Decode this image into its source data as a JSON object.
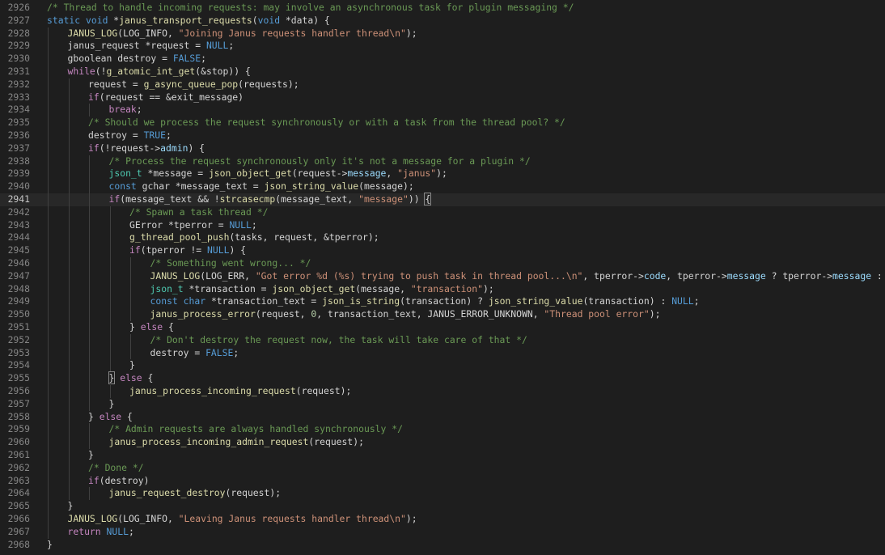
{
  "editor": {
    "active_line": 2941,
    "colors": {
      "background": "#1e1e1e",
      "line_number": "#858585",
      "active_line_number": "#c6c6c6",
      "keyword": "#569cd6",
      "control": "#c586c0",
      "function": "#dcdcaa",
      "type": "#4ec9b0",
      "variable": "#9cdcfe",
      "string": "#ce9178",
      "number": "#b5cea8",
      "comment": "#6a9955",
      "default": "#d4d4d4"
    },
    "lines": [
      {
        "n": "2926",
        "indent": 0,
        "tokens": [
          [
            "cmt",
            "/* Thread to handle incoming requests: may involve an asynchronous task for plugin messaging */"
          ]
        ]
      },
      {
        "n": "2927",
        "indent": 0,
        "tokens": [
          [
            "kw",
            "static"
          ],
          [
            "p",
            " "
          ],
          [
            "kw",
            "void"
          ],
          [
            "p",
            " *"
          ],
          [
            "fn",
            "janus_transport_requests"
          ],
          [
            "p",
            "("
          ],
          [
            "kw",
            "void"
          ],
          [
            "p",
            " *"
          ],
          [
            "p",
            "data) {"
          ]
        ]
      },
      {
        "n": "2928",
        "indent": 1,
        "tokens": [
          [
            "fn",
            "JANUS_LOG"
          ],
          [
            "p",
            "(LOG_INFO, "
          ],
          [
            "str",
            "\"Joining Janus requests handler thread\\n\""
          ],
          [
            "p",
            ");"
          ]
        ]
      },
      {
        "n": "2929",
        "indent": 1,
        "tokens": [
          [
            "p",
            "janus_request *request = "
          ],
          [
            "kw",
            "NULL"
          ],
          [
            "p",
            ";"
          ]
        ]
      },
      {
        "n": "2930",
        "indent": 1,
        "tokens": [
          [
            "p",
            "gboolean destroy = "
          ],
          [
            "kw",
            "FALSE"
          ],
          [
            "p",
            ";"
          ]
        ]
      },
      {
        "n": "2931",
        "indent": 1,
        "tokens": [
          [
            "ctl",
            "while"
          ],
          [
            "p",
            "(!"
          ],
          [
            "fn",
            "g_atomic_int_get"
          ],
          [
            "p",
            "(&stop)) {"
          ]
        ]
      },
      {
        "n": "2932",
        "indent": 2,
        "tokens": [
          [
            "p",
            "request = "
          ],
          [
            "fn",
            "g_async_queue_pop"
          ],
          [
            "p",
            "(requests);"
          ]
        ]
      },
      {
        "n": "2933",
        "indent": 2,
        "tokens": [
          [
            "ctl",
            "if"
          ],
          [
            "p",
            "(request == &exit_message)"
          ]
        ]
      },
      {
        "n": "2934",
        "indent": 3,
        "tokens": [
          [
            "ctl",
            "break"
          ],
          [
            "p",
            ";"
          ]
        ]
      },
      {
        "n": "2935",
        "indent": 2,
        "tokens": [
          [
            "cmt",
            "/* Should we process the request synchronously or with a task from the thread pool? */"
          ]
        ]
      },
      {
        "n": "2936",
        "indent": 2,
        "tokens": [
          [
            "p",
            "destroy = "
          ],
          [
            "kw",
            "TRUE"
          ],
          [
            "p",
            ";"
          ]
        ]
      },
      {
        "n": "2937",
        "indent": 2,
        "tokens": [
          [
            "ctl",
            "if"
          ],
          [
            "p",
            "(!request->"
          ],
          [
            "var",
            "admin"
          ],
          [
            "p",
            ") {"
          ]
        ]
      },
      {
        "n": "2938",
        "indent": 3,
        "tokens": [
          [
            "cmt",
            "/* Process the request synchronously only it's not a message for a plugin */"
          ]
        ]
      },
      {
        "n": "2939",
        "indent": 3,
        "tokens": [
          [
            "type",
            "json_t"
          ],
          [
            "p",
            " *message = "
          ],
          [
            "fn",
            "json_object_get"
          ],
          [
            "p",
            "(request->"
          ],
          [
            "var",
            "message"
          ],
          [
            "p",
            ", "
          ],
          [
            "str",
            "\"janus\""
          ],
          [
            "p",
            ");"
          ]
        ]
      },
      {
        "n": "2940",
        "indent": 3,
        "tokens": [
          [
            "kw",
            "const"
          ],
          [
            "p",
            " gchar *message_text = "
          ],
          [
            "fn",
            "json_string_value"
          ],
          [
            "p",
            "(message);"
          ]
        ]
      },
      {
        "n": "2941",
        "indent": 3,
        "tokens": [
          [
            "ctl",
            "if"
          ],
          [
            "p",
            "(message_text && !"
          ],
          [
            "fn",
            "strcasecmp"
          ],
          [
            "p",
            "(message_text, "
          ],
          [
            "str",
            "\"message\""
          ],
          [
            "p",
            ")) "
          ],
          [
            "brkm",
            "{"
          ]
        ]
      },
      {
        "n": "2942",
        "indent": 4,
        "tokens": [
          [
            "cmt",
            "/* Spawn a task thread */"
          ]
        ]
      },
      {
        "n": "2943",
        "indent": 4,
        "tokens": [
          [
            "p",
            "GError *tperror = "
          ],
          [
            "kw",
            "NULL"
          ],
          [
            "p",
            ";"
          ]
        ]
      },
      {
        "n": "2944",
        "indent": 4,
        "tokens": [
          [
            "fn",
            "g_thread_pool_push"
          ],
          [
            "p",
            "(tasks, request, &tperror);"
          ]
        ]
      },
      {
        "n": "2945",
        "indent": 4,
        "tokens": [
          [
            "ctl",
            "if"
          ],
          [
            "p",
            "(tperror != "
          ],
          [
            "kw",
            "NULL"
          ],
          [
            "p",
            ") {"
          ]
        ]
      },
      {
        "n": "2946",
        "indent": 5,
        "tokens": [
          [
            "cmt",
            "/* Something went wrong... */"
          ]
        ]
      },
      {
        "n": "2947",
        "indent": 5,
        "tokens": [
          [
            "fn",
            "JANUS_LOG"
          ],
          [
            "p",
            "(LOG_ERR, "
          ],
          [
            "str",
            "\"Got error %d (%s) trying to push task in thread pool...\\n\""
          ],
          [
            "p",
            ", tperror->"
          ],
          [
            "var",
            "code"
          ],
          [
            "p",
            ", tperror->"
          ],
          [
            "var",
            "message"
          ],
          [
            "p",
            " ? tperror->"
          ],
          [
            "var",
            "message"
          ],
          [
            "p",
            " : "
          ],
          [
            "str",
            "\"??\""
          ],
          [
            "p",
            ");"
          ]
        ]
      },
      {
        "n": "2948",
        "indent": 5,
        "tokens": [
          [
            "type",
            "json_t"
          ],
          [
            "p",
            " *transaction = "
          ],
          [
            "fn",
            "json_object_get"
          ],
          [
            "p",
            "(message, "
          ],
          [
            "str",
            "\"transaction\""
          ],
          [
            "p",
            ");"
          ]
        ]
      },
      {
        "n": "2949",
        "indent": 5,
        "tokens": [
          [
            "kw",
            "const"
          ],
          [
            "p",
            " "
          ],
          [
            "kw",
            "char"
          ],
          [
            "p",
            " *transaction_text = "
          ],
          [
            "fn",
            "json_is_string"
          ],
          [
            "p",
            "(transaction) ? "
          ],
          [
            "fn",
            "json_string_value"
          ],
          [
            "p",
            "(transaction) : "
          ],
          [
            "kw",
            "NULL"
          ],
          [
            "p",
            ";"
          ]
        ]
      },
      {
        "n": "2950",
        "indent": 5,
        "tokens": [
          [
            "fn",
            "janus_process_error"
          ],
          [
            "p",
            "(request, "
          ],
          [
            "num",
            "0"
          ],
          [
            "p",
            ", transaction_text, JANUS_ERROR_UNKNOWN, "
          ],
          [
            "str",
            "\"Thread pool error\""
          ],
          [
            "p",
            ");"
          ]
        ]
      },
      {
        "n": "2951",
        "indent": 4,
        "tokens": [
          [
            "p",
            "} "
          ],
          [
            "ctl",
            "else"
          ],
          [
            "p",
            " {"
          ]
        ]
      },
      {
        "n": "2952",
        "indent": 5,
        "tokens": [
          [
            "cmt",
            "/* Don't destroy the request now, the task will take care of that */"
          ]
        ]
      },
      {
        "n": "2953",
        "indent": 5,
        "tokens": [
          [
            "p",
            "destroy = "
          ],
          [
            "kw",
            "FALSE"
          ],
          [
            "p",
            ";"
          ]
        ]
      },
      {
        "n": "2954",
        "indent": 4,
        "tokens": [
          [
            "p",
            "}"
          ]
        ]
      },
      {
        "n": "2955",
        "indent": 3,
        "tokens": [
          [
            "brkm",
            "}"
          ],
          [
            "p",
            " "
          ],
          [
            "ctl",
            "else"
          ],
          [
            "p",
            " {"
          ]
        ]
      },
      {
        "n": "2956",
        "indent": 4,
        "tokens": [
          [
            "fn",
            "janus_process_incoming_request"
          ],
          [
            "p",
            "(request);"
          ]
        ]
      },
      {
        "n": "2957",
        "indent": 3,
        "tokens": [
          [
            "p",
            "}"
          ]
        ]
      },
      {
        "n": "2958",
        "indent": 2,
        "tokens": [
          [
            "p",
            "} "
          ],
          [
            "ctl",
            "else"
          ],
          [
            "p",
            " {"
          ]
        ]
      },
      {
        "n": "2959",
        "indent": 3,
        "tokens": [
          [
            "cmt",
            "/* Admin requests are always handled synchronously */"
          ]
        ]
      },
      {
        "n": "2960",
        "indent": 3,
        "tokens": [
          [
            "fn",
            "janus_process_incoming_admin_request"
          ],
          [
            "p",
            "(request);"
          ]
        ]
      },
      {
        "n": "2961",
        "indent": 2,
        "tokens": [
          [
            "p",
            "}"
          ]
        ]
      },
      {
        "n": "2962",
        "indent": 2,
        "tokens": [
          [
            "cmt",
            "/* Done */"
          ]
        ]
      },
      {
        "n": "2963",
        "indent": 2,
        "tokens": [
          [
            "ctl",
            "if"
          ],
          [
            "p",
            "(destroy)"
          ]
        ]
      },
      {
        "n": "2964",
        "indent": 3,
        "tokens": [
          [
            "fn",
            "janus_request_destroy"
          ],
          [
            "p",
            "(request);"
          ]
        ]
      },
      {
        "n": "2965",
        "indent": 1,
        "tokens": [
          [
            "p",
            "}"
          ]
        ]
      },
      {
        "n": "2966",
        "indent": 1,
        "tokens": [
          [
            "fn",
            "JANUS_LOG"
          ],
          [
            "p",
            "(LOG_INFO, "
          ],
          [
            "str",
            "\"Leaving Janus requests handler thread\\n\""
          ],
          [
            "p",
            ");"
          ]
        ]
      },
      {
        "n": "2967",
        "indent": 1,
        "tokens": [
          [
            "ctl",
            "return"
          ],
          [
            "p",
            " "
          ],
          [
            "kw",
            "NULL"
          ],
          [
            "p",
            ";"
          ]
        ]
      },
      {
        "n": "2968",
        "indent": 0,
        "tokens": [
          [
            "p",
            "}"
          ]
        ]
      }
    ]
  }
}
